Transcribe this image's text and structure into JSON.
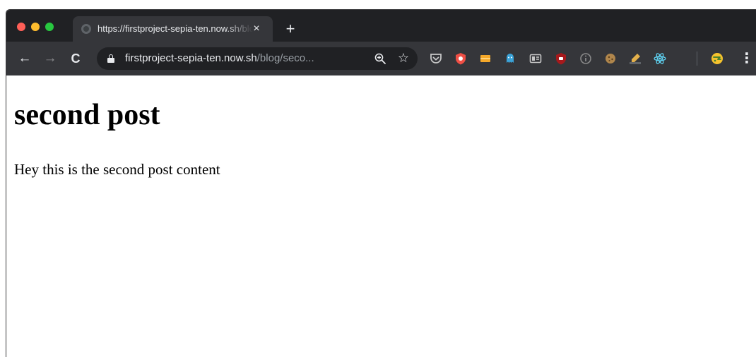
{
  "browser": {
    "tab": {
      "title": "https://firstproject-sepia-ten.now.sh/blog/second",
      "close_icon": "×",
      "favicon_icon": "globe-icon"
    },
    "new_tab_icon": "+",
    "nav": {
      "back_icon": "←",
      "forward_icon": "→",
      "reload_icon": "C"
    },
    "address_bar": {
      "host": "firstproject-sepia-ten.now.sh",
      "path": "/blog/seco...",
      "secure_icon": "lock-icon",
      "zoom_icon": "zoom-icon",
      "bookmark_icon": "☆"
    },
    "extensions": [
      {
        "name": "pocket-icon",
        "color": "#c8c8c8"
      },
      {
        "name": "privacy-badger-icon",
        "color": "#ef4f45"
      },
      {
        "name": "mailtrack-icon",
        "color": "#f4a82a"
      },
      {
        "name": "ghostery-icon",
        "color": "#3ba3d8"
      },
      {
        "name": "reader-icon",
        "color": "#c8c8c8"
      },
      {
        "name": "ublock-icon",
        "color": "#a6191c"
      },
      {
        "name": "info-icon",
        "color": "#8a8a8a"
      },
      {
        "name": "cookie-icon",
        "color": "#b0864c"
      },
      {
        "name": "css-icon",
        "color": "#e3b04b"
      },
      {
        "name": "react-devtools-icon",
        "color": "#61dafb"
      },
      {
        "name": "profile-avatar-icon",
        "color": "#f6c32d"
      }
    ],
    "menu_icon": "⋮"
  },
  "page": {
    "heading": "second post",
    "body": "Hey this is the second post content"
  }
}
